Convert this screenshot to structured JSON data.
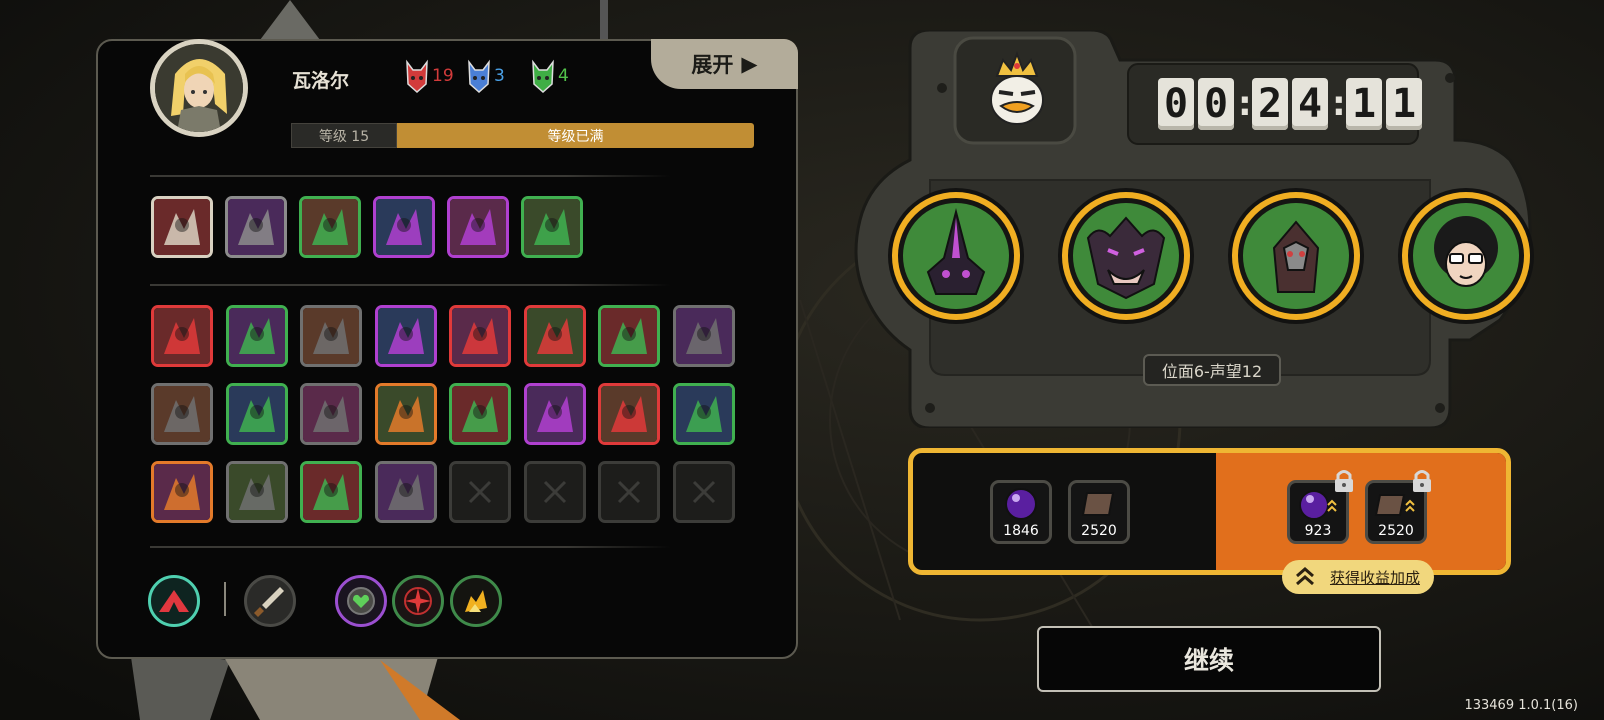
{
  "hero": {
    "name": "瓦洛尔",
    "resources": [
      {
        "icon": "red-mask-icon",
        "value": "19",
        "color": "#d23b3b"
      },
      {
        "icon": "blue-mask-icon",
        "value": "3",
        "color": "#4aa0e6"
      },
      {
        "icon": "green-mask-icon",
        "value": "4",
        "color": "#52c24a"
      }
    ],
    "level_label": "等级 15",
    "level_status": "等级已满"
  },
  "expand_button": {
    "label": "展开",
    "icon": "triangle-right-icon"
  },
  "active_skills": [
    {
      "icon": "skill-cloak-icon",
      "color": "#d9d1c1"
    },
    {
      "icon": "skill-hand-icon",
      "color": "#8c8c8c"
    },
    {
      "icon": "skill-grab-icon",
      "color": "#40b050"
    },
    {
      "icon": "skill-fist-icon",
      "color": "#b040d0"
    },
    {
      "icon": "skill-vortex-icon",
      "color": "#b040d0"
    },
    {
      "icon": "skill-shade-icon",
      "color": "#40b050"
    }
  ],
  "relics": [
    {
      "icon": "relic-spear-icon",
      "color": "#e03a3a"
    },
    {
      "icon": "relic-blades-icon",
      "color": "#40b050"
    },
    {
      "icon": "relic-spine-icon",
      "color": "#707070"
    },
    {
      "icon": "relic-crown-icon",
      "color": "#b040d0"
    },
    {
      "icon": "relic-demon-icon",
      "color": "#e03a3a"
    },
    {
      "icon": "relic-moon-icon",
      "color": "#e03a3a"
    },
    {
      "icon": "relic-wolf-icon",
      "color": "#40b050"
    },
    {
      "icon": "relic-shrine-icon",
      "color": "#707070"
    },
    {
      "icon": "relic-claw-icon",
      "color": "#707070"
    },
    {
      "icon": "relic-web-icon",
      "color": "#40b050"
    },
    {
      "icon": "relic-urchin-icon",
      "color": "#707070"
    },
    {
      "icon": "relic-compass-icon",
      "color": "#e37a2a"
    },
    {
      "icon": "relic-hood-icon",
      "color": "#40b050"
    },
    {
      "icon": "relic-eye-icon",
      "color": "#b040d0"
    },
    {
      "icon": "relic-slash-icon",
      "color": "#e03a3a"
    },
    {
      "icon": "relic-reaper-icon",
      "color": "#40b050"
    },
    {
      "icon": "relic-spikes-icon",
      "color": "#e37a2a"
    },
    {
      "icon": "relic-crack-icon",
      "color": "#707070"
    },
    {
      "icon": "relic-crystal-icon",
      "color": "#40b050"
    },
    {
      "icon": "relic-flame-icon",
      "color": "#707070"
    },
    {
      "icon": "empty-slot-icon",
      "color": "#3c3c39"
    },
    {
      "icon": "empty-slot-icon",
      "color": "#3c3c39"
    },
    {
      "icon": "empty-slot-icon",
      "color": "#3c3c39"
    },
    {
      "icon": "empty-slot-icon",
      "color": "#3c3c39"
    }
  ],
  "bottom_icons": [
    "tent-icon",
    "dagger-icon",
    "heart-gem-icon",
    "red-compass-icon",
    "burst-icon"
  ],
  "timer": {
    "digits": [
      "0",
      "0",
      "2",
      "4",
      "1",
      "1"
    ]
  },
  "realm_label": "位面6-声望12",
  "enemies": [
    {
      "icon": "enemy-spike-icon"
    },
    {
      "icon": "enemy-demon-icon"
    },
    {
      "icon": "enemy-hooded-icon"
    },
    {
      "icon": "enemy-glasses-icon"
    }
  ],
  "rewards": {
    "base": [
      {
        "icon": "purple-orb-icon",
        "count": "1846"
      },
      {
        "icon": "tile-icon",
        "count": "2520"
      }
    ],
    "bonus": [
      {
        "icon": "purple-orb-icon",
        "count": "923",
        "locked": true
      },
      {
        "icon": "tile-icon",
        "count": "2520",
        "locked": true
      }
    ],
    "bonus_link": "获得收益加成"
  },
  "continue_button": "继续",
  "version": "133469 1.0.1(16)"
}
